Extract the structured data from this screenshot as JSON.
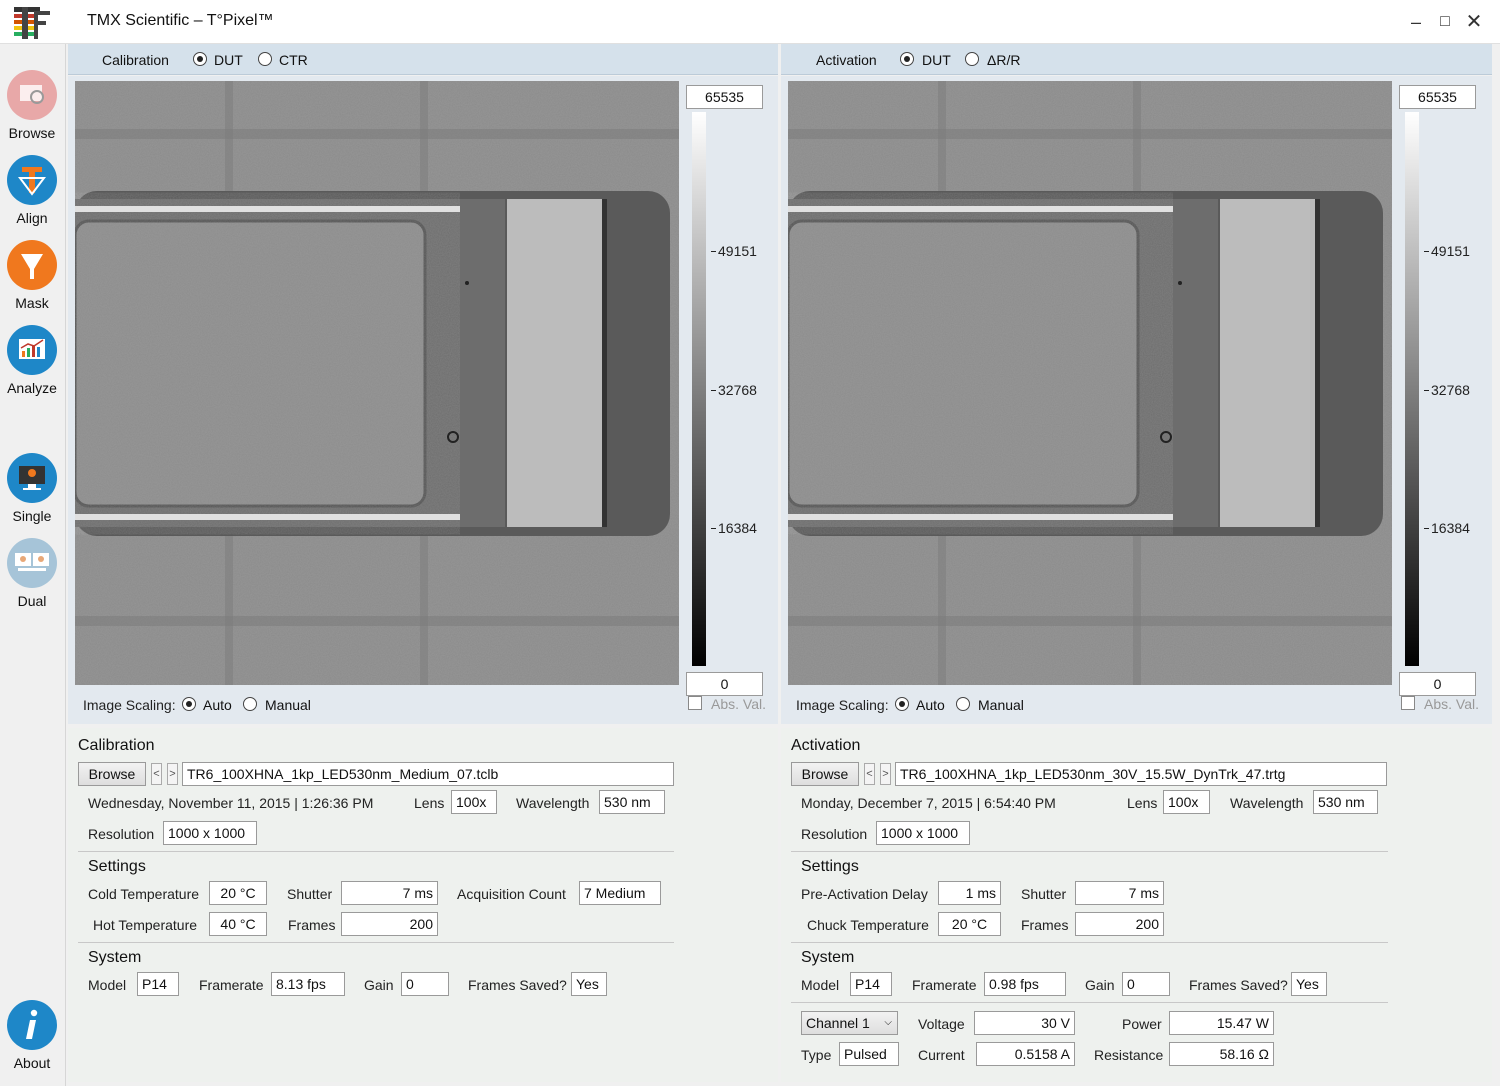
{
  "window": {
    "title": "TMX Scientific – T°Pixel™"
  },
  "sidebar": {
    "items": [
      {
        "label": "Browse"
      },
      {
        "label": "Align"
      },
      {
        "label": "Mask"
      },
      {
        "label": "Analyze"
      },
      {
        "label": "Single"
      },
      {
        "label": "Dual"
      },
      {
        "label": "About"
      }
    ]
  },
  "colors": {
    "accent": "#1e87c8",
    "orange": "#f0781e",
    "header": "#d5e1eb"
  },
  "left": {
    "header": {
      "title": "Calibration",
      "opt1": "DUT",
      "opt2": "CTR",
      "selected": "DUT"
    },
    "scale": {
      "max": "65535",
      "t1": "49151",
      "t2": "32768",
      "t3": "16384",
      "min": "0",
      "abs": "Abs. Val."
    },
    "scaling": {
      "label": "Image Scaling:",
      "auto": "Auto",
      "manual": "Manual",
      "selected": "Auto"
    },
    "panel": {
      "title": "Calibration",
      "browse": "Browse",
      "prev": "<",
      "next": ">",
      "file": "TR6_100XHNA_1kp_LED530nm_Medium_07.tclb",
      "date": "Wednesday, November 11, 2015 | 1:26:36 PM",
      "lens_label": "Lens",
      "lens": "100x",
      "wavelength_label": "Wavelength",
      "wavelength": "530 nm",
      "resolution_label": "Resolution",
      "resolution": "1000 x 1000",
      "settings": "Settings",
      "cold_label": "Cold Temperature",
      "cold": "20 °C",
      "shutter_label": "Shutter",
      "shutter": "7 ms",
      "acq_label": "Acquisition Count",
      "acq": "7 Medium",
      "hot_label": "Hot Temperature",
      "hot": "40 °C",
      "frames_label": "Frames",
      "frames": "200",
      "system": "System",
      "model_label": "Model",
      "model": "P14",
      "framerate_label": "Framerate",
      "framerate": "8.13 fps",
      "gain_label": "Gain",
      "gain": "0",
      "saved_label": "Frames Saved?",
      "saved": "Yes"
    }
  },
  "right": {
    "header": {
      "title": "Activation",
      "opt1": "DUT",
      "opt2": "ΔR/R",
      "selected": "DUT"
    },
    "scale": {
      "max": "65535",
      "t1": "49151",
      "t2": "32768",
      "t3": "16384",
      "min": "0",
      "abs": "Abs. Val."
    },
    "scaling": {
      "label": "Image Scaling:",
      "auto": "Auto",
      "manual": "Manual",
      "selected": "Auto"
    },
    "panel": {
      "title": "Activation",
      "browse": "Browse",
      "prev": "<",
      "next": ">",
      "file": "TR6_100XHNA_1kp_LED530nm_30V_15.5W_DynTrk_47.trtg",
      "date": "Monday, December 7, 2015 | 6:54:40 PM",
      "lens_label": "Lens",
      "lens": "100x",
      "wavelength_label": "Wavelength",
      "wavelength": "530 nm",
      "resolution_label": "Resolution",
      "resolution": "1000 x 1000",
      "settings": "Settings",
      "delay_label": "Pre-Activation Delay",
      "delay": "1 ms",
      "shutter_label": "Shutter",
      "shutter": "7 ms",
      "chuck_label": "Chuck Temperature",
      "chuck": "20 °C",
      "frames_label": "Frames",
      "frames": "200",
      "system": "System",
      "model_label": "Model",
      "model": "P14",
      "framerate_label": "Framerate",
      "framerate": "0.98 fps",
      "gain_label": "Gain",
      "gain": "0",
      "saved_label": "Frames Saved?",
      "saved": "Yes",
      "channel": "Channel 1",
      "voltage_label": "Voltage",
      "voltage": "30 V",
      "power_label": "Power",
      "power": "15.47 W",
      "type_label": "Type",
      "type": "Pulsed",
      "current_label": "Current",
      "current": "0.5158 A",
      "resistance_label": "Resistance",
      "resistance": "58.16 Ω"
    }
  }
}
